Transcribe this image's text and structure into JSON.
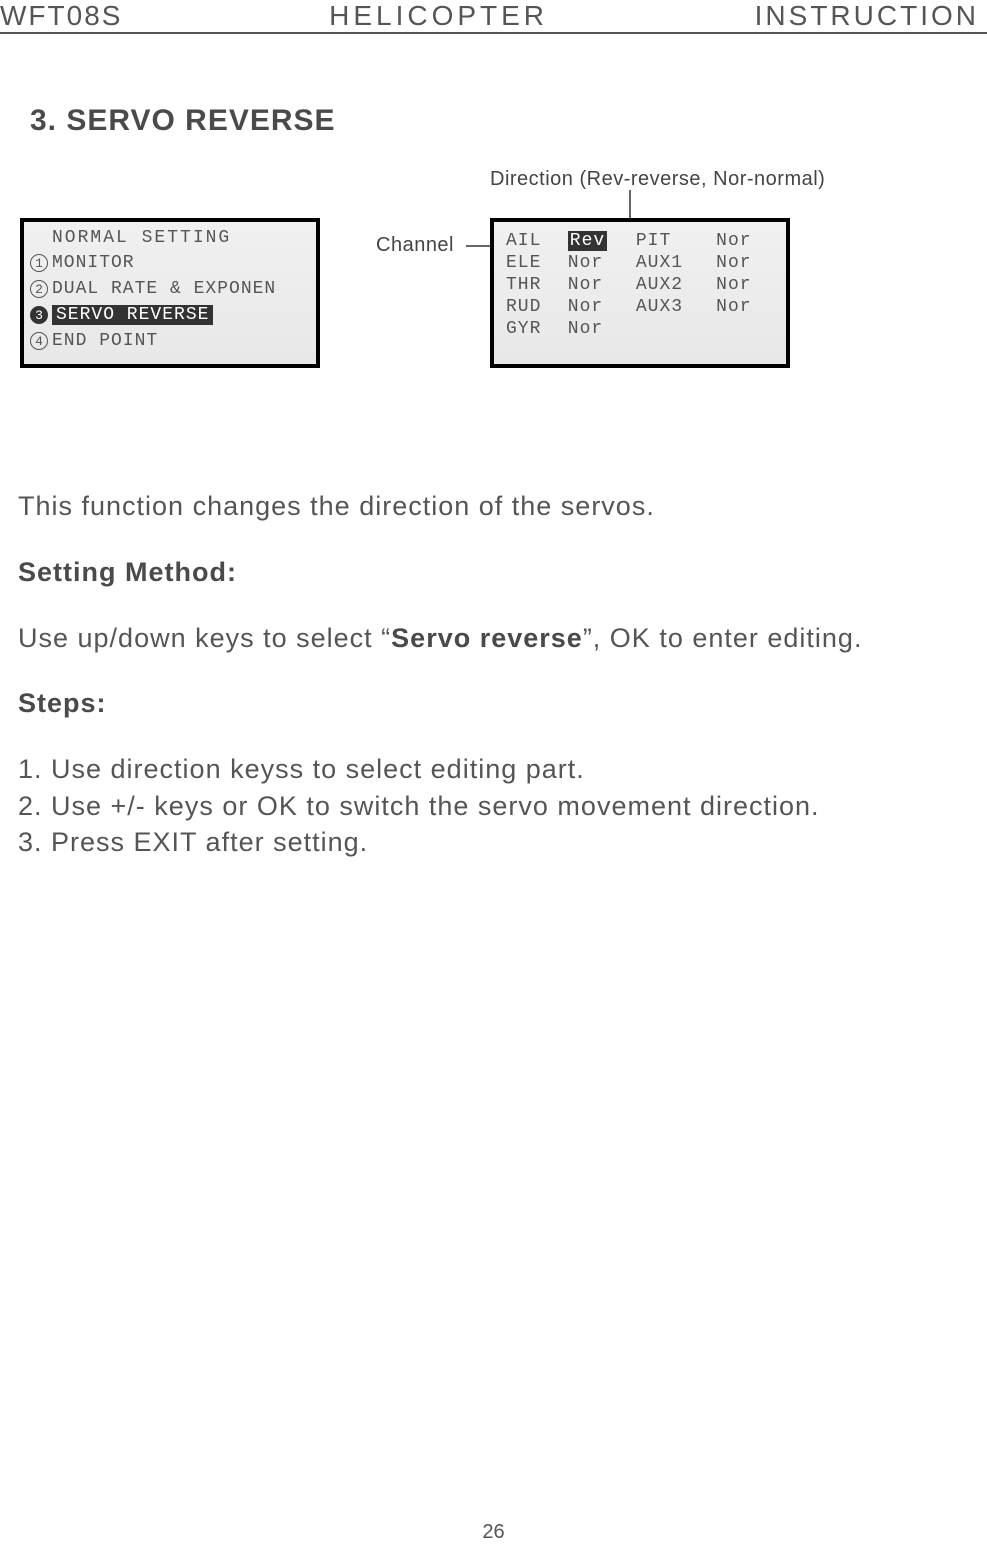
{
  "header": {
    "left": "WFT08S",
    "center": "HELICOPTER",
    "right": "INSTRUCTION"
  },
  "section_title": "3. SERVO REVERSE",
  "annotations": {
    "direction": "Direction (Rev-reverse, Nor-normal)",
    "channel": "Channel"
  },
  "lcd_menu": {
    "title": "NORMAL SETTING",
    "items": [
      {
        "num": "1",
        "label": "MONITOR",
        "selected": false
      },
      {
        "num": "2",
        "label": "DUAL RATE & EXPONEN",
        "selected": false
      },
      {
        "num": "3",
        "label": "SERVO REVERSE",
        "selected": true
      },
      {
        "num": "4",
        "label": "END POINT",
        "selected": false
      }
    ]
  },
  "lcd_servo": {
    "rows": [
      {
        "c1": "AIL",
        "v1": "Rev",
        "v1_sel": true,
        "c2": "PIT",
        "v2": "Nor"
      },
      {
        "c1": "ELE",
        "v1": "Nor",
        "v1_sel": false,
        "c2": "AUX1",
        "v2": "Nor"
      },
      {
        "c1": "THR",
        "v1": "Nor",
        "v1_sel": false,
        "c2": "AUX2",
        "v2": "Nor"
      },
      {
        "c1": "RUD",
        "v1": "Nor",
        "v1_sel": false,
        "c2": "AUX3",
        "v2": "Nor"
      },
      {
        "c1": "GYR",
        "v1": "Nor",
        "v1_sel": false,
        "c2": "",
        "v2": ""
      }
    ]
  },
  "body": {
    "intro": "This function changes the direction of the servos.",
    "setting_method_label": "Setting Method:",
    "setting_method_text_pre": "Use up/down keys to select “",
    "setting_method_text_bold": "Servo reverse",
    "setting_method_text_post": "”, OK to enter editing.",
    "steps_label": "Steps:",
    "steps": [
      "1. Use direction keyss to select editing part.",
      "2. Use +/- keys or OK to switch the servo movement direction.",
      "3. Press EXIT after setting."
    ]
  },
  "page_number": "26"
}
